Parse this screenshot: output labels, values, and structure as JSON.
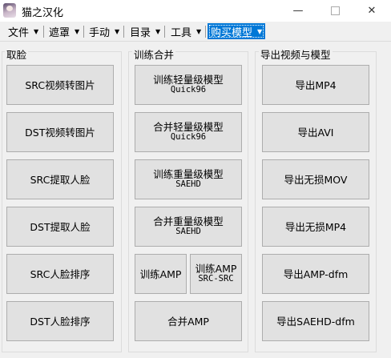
{
  "window": {
    "title": "猫之汉化",
    "minimize_glyph": "—",
    "close_glyph": "✕"
  },
  "menubar": {
    "items": [
      {
        "label": "文件",
        "arrow": "▼"
      },
      {
        "label": "遮罩",
        "arrow": "▼"
      },
      {
        "label": "手动",
        "arrow": "▼"
      },
      {
        "label": "目录",
        "arrow": "▼"
      },
      {
        "label": "工具",
        "arrow": "▼"
      },
      {
        "label": "购买模型",
        "arrow": "▼",
        "active": true
      }
    ]
  },
  "groups": {
    "extract": {
      "label": "取脸",
      "buttons": [
        {
          "label": "SRC视频转图片"
        },
        {
          "label": "DST视频转图片"
        },
        {
          "label": "SRC提取人脸"
        },
        {
          "label": "DST提取人脸"
        },
        {
          "label": "SRC人脸排序"
        },
        {
          "label": "DST人脸排序"
        }
      ]
    },
    "train": {
      "label": "训练合并",
      "buttons": [
        {
          "line1": "训练轻量级模型",
          "line2": "Quick96"
        },
        {
          "line1": "合并轻量级模型",
          "line2": "Quick96"
        },
        {
          "line1": "训练重量级模型",
          "line2": "SAEHD"
        },
        {
          "line1": "合并重量级模型",
          "line2": "SAEHD"
        },
        {
          "line1": "训练AMP",
          "line2": ""
        },
        {
          "line1": "训练AMP",
          "line2": "SRC-SRC"
        },
        {
          "line1": "合并AMP",
          "line2": ""
        }
      ]
    },
    "export": {
      "label": "导出视频与模型",
      "buttons": [
        {
          "label": "导出MP4"
        },
        {
          "label": "导出AVI"
        },
        {
          "label": "导出无损MOV"
        },
        {
          "label": "导出无损MP4"
        },
        {
          "label": "导出AMP-dfm"
        },
        {
          "label": "导出SAEHD-dfm"
        }
      ]
    }
  },
  "colors": {
    "window_bg": "#f0f0f0",
    "button_bg": "#e1e1e1",
    "button_border": "#adadad",
    "menu_active_bg": "#0078d7"
  }
}
